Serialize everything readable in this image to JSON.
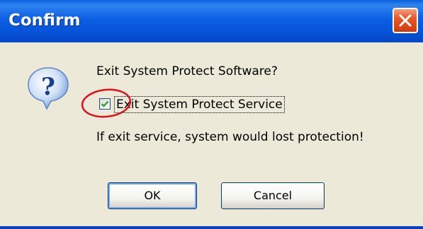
{
  "dialog": {
    "title": "Confirm",
    "question_icon": "question-icon",
    "close_icon": "close-icon",
    "message": "Exit System Protect Software?",
    "checkbox": {
      "label": "Exit System Protect Service",
      "checked": true
    },
    "warning": "If exit service, system would lost protection!",
    "buttons": {
      "ok": "OK",
      "cancel": "Cancel"
    },
    "colors": {
      "titlebar": "#0451d4",
      "close_button": "#e8572a",
      "background": "#ece9d8",
      "annotation_circle": "#e0101a",
      "check_mark": "#21a121"
    }
  }
}
